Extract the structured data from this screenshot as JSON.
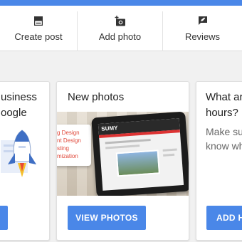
{
  "accent_color": "#4a87e8",
  "actions": [
    {
      "label": "Create post",
      "icon": "post-icon"
    },
    {
      "label": "Add photo",
      "icon": "add-photo-icon"
    },
    {
      "label": "Reviews",
      "icon": "reviews-icon"
    }
  ],
  "cards": {
    "business": {
      "title": "usiness\noogle",
      "button": ""
    },
    "photos": {
      "title": "New photos",
      "button": "VIEW PHOTOS",
      "photo_site_title": "SUMY",
      "photo_text": "g Design\nnt Design\nsting\nmization"
    },
    "hours": {
      "title": "What are\nhours?",
      "text": "Make sur\nknow wh",
      "button": "ADD H"
    }
  }
}
